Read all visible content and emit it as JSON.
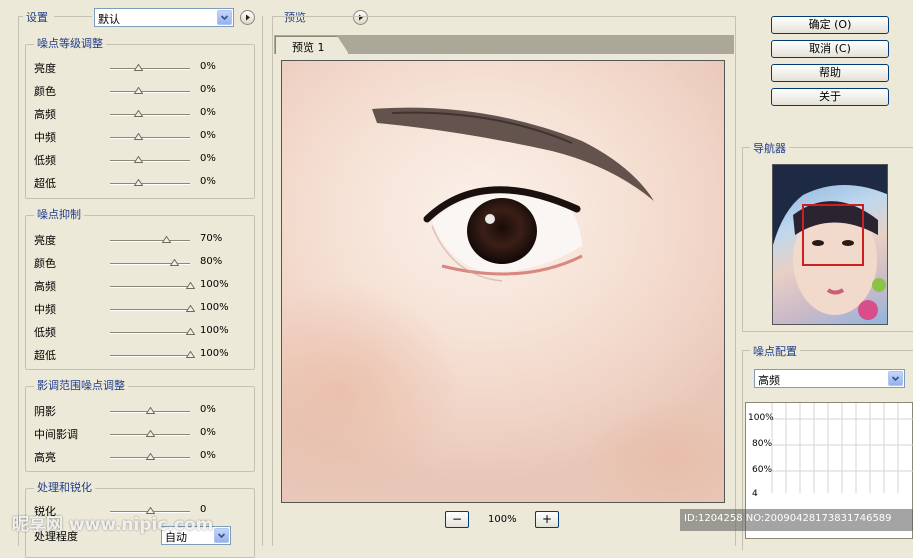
{
  "settings": {
    "label": "设置",
    "preset_value": "默认"
  },
  "preview": {
    "label": "预览",
    "tab_label": "预览 1",
    "zoom_out_label": "−",
    "zoom": "100%",
    "zoom_in_label": "+"
  },
  "groups": [
    {
      "title": "噪点等级调整",
      "rows": [
        {
          "label": "亮度",
          "value": "0%",
          "level": 0.35
        },
        {
          "label": "颜色",
          "value": "0%",
          "level": 0.35
        },
        {
          "label": "高频",
          "value": "0%",
          "level": 0.35
        },
        {
          "label": "中频",
          "value": "0%",
          "level": 0.35
        },
        {
          "label": "低频",
          "value": "0%",
          "level": 0.35
        },
        {
          "label": "超低",
          "value": "0%",
          "level": 0.35
        }
      ]
    },
    {
      "title": "噪点抑制",
      "rows": [
        {
          "label": "亮度",
          "value": "70%",
          "level": 0.7
        },
        {
          "label": "颜色",
          "value": "80%",
          "level": 0.8
        },
        {
          "label": "高频",
          "value": "100%",
          "level": 1.0
        },
        {
          "label": "中频",
          "value": "100%",
          "level": 1.0
        },
        {
          "label": "低频",
          "value": "100%",
          "level": 1.0
        },
        {
          "label": "超低",
          "value": "100%",
          "level": 1.0
        }
      ]
    },
    {
      "title": "影调范围噪点调整",
      "rows": [
        {
          "label": "阴影",
          "value": "0%",
          "level": 0.5
        },
        {
          "label": "中间影调",
          "value": "0%",
          "level": 0.5
        },
        {
          "label": "高亮",
          "value": "0%",
          "level": 0.5
        }
      ]
    },
    {
      "title": "处理和锐化",
      "rows": [
        {
          "label": "锐化",
          "value": "0",
          "level": 0.5
        }
      ]
    }
  ],
  "processing": {
    "label": "处理程度",
    "value": "自动"
  },
  "buttons": {
    "ok": "确定 (O)",
    "cancel": "取消 (C)",
    "help": "帮助",
    "about": "关于"
  },
  "navigator": {
    "label": "导航器"
  },
  "noise_profile": {
    "label": "噪点配置",
    "select_value": "高频",
    "y_ticks": [
      "100%",
      "80%",
      "60%",
      "4"
    ]
  },
  "watermark": {
    "logo": "昵享网 www.nipic.com",
    "id_text": "ID:1204258 NO:20090428173831746589"
  },
  "colors": {
    "group_title": "#1F3C88",
    "dialog_bg": "#ECE9D8",
    "nav_rect": "#CC1F1F"
  }
}
